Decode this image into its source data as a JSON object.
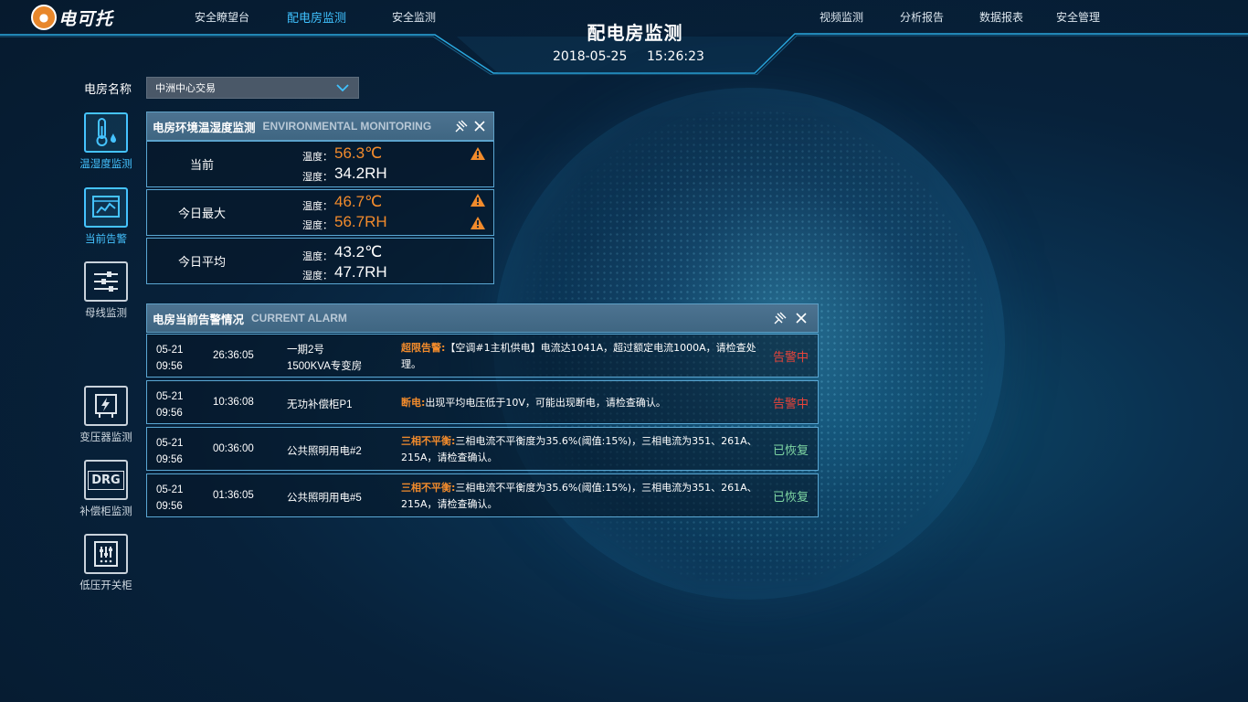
{
  "header": {
    "logo_text": "电可托",
    "nav_left": [
      "安全瞭望台",
      "配电房监测",
      "安全监测"
    ],
    "nav_right": [
      "视频监测",
      "分析报告",
      "数据报表",
      "安全管理"
    ],
    "title": "配电房监测",
    "date": "2018-05-25",
    "time": "15:26:23"
  },
  "room": {
    "label": "电房名称",
    "selected": "中洲中心交易"
  },
  "sidebar": [
    {
      "label": "温湿度监测",
      "icon": "thermometer-drop-icon",
      "active": true
    },
    {
      "label": "当前告警",
      "icon": "alarm-chart-icon",
      "active": true
    },
    {
      "label": "母线监测",
      "icon": "busbar-icon",
      "active": false
    },
    {
      "label": "变压器监测",
      "icon": "transformer-icon",
      "active": false
    },
    {
      "label": "补偿柜监测",
      "icon": "drg-icon",
      "active": false
    },
    {
      "label": "低压开关柜",
      "icon": "switchgear-icon",
      "active": false
    }
  ],
  "sidebar_drg_text": "DRG",
  "env": {
    "title": "电房环境温湿度监测",
    "subtitle": "ENVIRONMENTAL MONITORING",
    "rows": [
      {
        "name": "当前",
        "t_label": "温度：",
        "t_value": "56.3℃",
        "h_label": "湿度：",
        "h_value": "34.2RH"
      },
      {
        "name": "今日最大",
        "t_label": "温度：",
        "t_value": "46.7℃",
        "h_label": "湿度：",
        "h_value": "56.7RH"
      },
      {
        "name": "今日平均",
        "t_label": "温度：",
        "t_value": "43.2℃",
        "h_label": "湿度：",
        "h_value": "47.7RH"
      }
    ]
  },
  "alarm": {
    "title": "电房当前告警情况",
    "subtitle": "CURRENT ALARM",
    "rows": [
      {
        "date": "05-21",
        "time": "09:56",
        "duration": "26:36:05",
        "device1": "一期2号",
        "device2": "1500KVA专变房",
        "type": "超限告警:",
        "msg": "【空调#1主机供电】电流达1041A，超过额定电流1000A，请检查处理。",
        "status": "告警中"
      },
      {
        "date": "05-21",
        "time": "09:56",
        "duration": "10:36:08",
        "device1": "无功补偿柜P1",
        "device2": "",
        "type": "断电:",
        "msg": "出现平均电压低于10V，可能出现断电，请检查确认。",
        "status": "告警中"
      },
      {
        "date": "05-21",
        "time": "09:56",
        "duration": "00:36:00",
        "device1": "公共照明用电#2",
        "device2": "",
        "type": "三相不平衡:",
        "msg": "三相电流不平衡度为35.6%(阈值:15%)，三相电流为351、261A、215A，请检查确认。",
        "status": "已恢复"
      },
      {
        "date": "05-21",
        "time": "09:56",
        "duration": "01:36:05",
        "device1": "公共照明用电#5",
        "device2": "",
        "type": "三相不平衡:",
        "msg": "三相电流不平衡度为35.6%(阈值:15%)，三相电流为351、261A、215A，请检查确认。",
        "status": "已恢复"
      }
    ]
  },
  "colors": {
    "accent": "#3fc2ff",
    "warn_orange": "#f28b2c",
    "alarm_red": "#e8443a",
    "ok_green": "#7ed6a3",
    "panel_head": "#46708e"
  }
}
